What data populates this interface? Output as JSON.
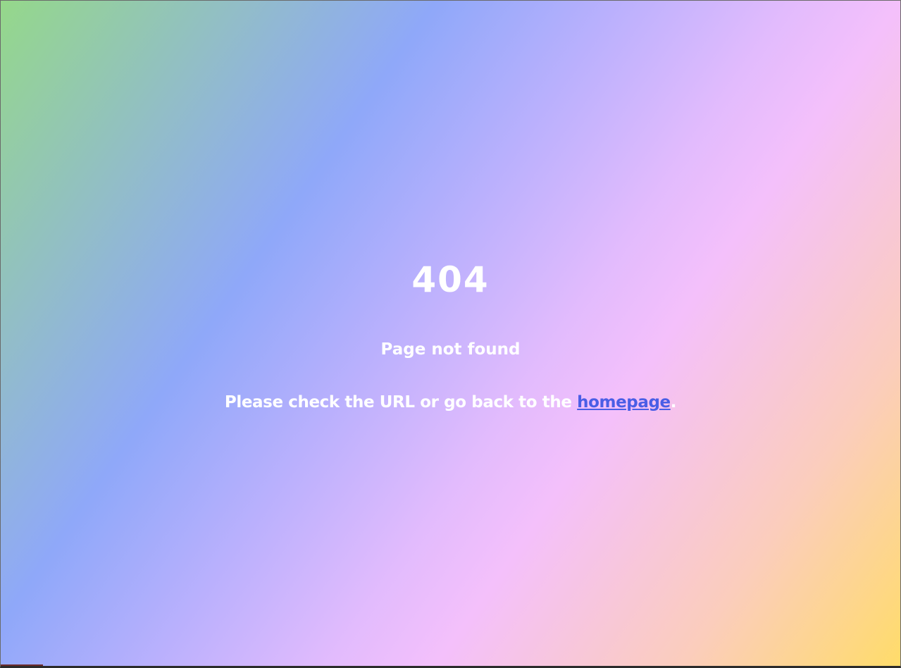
{
  "error": {
    "code": "404",
    "title": "Page not found",
    "message_prefix": "Please check the URL or go back to the ",
    "link_label": "homepage",
    "message_suffix": "."
  },
  "colors": {
    "gradient": [
      "#95d88a",
      "#8fa8f9",
      "#b9b0fd",
      "#e2bbfd",
      "#f4c0fb",
      "#fbcdbc",
      "#ffdc6a"
    ],
    "text": "#ffffff",
    "link": "#4a5ee6"
  }
}
